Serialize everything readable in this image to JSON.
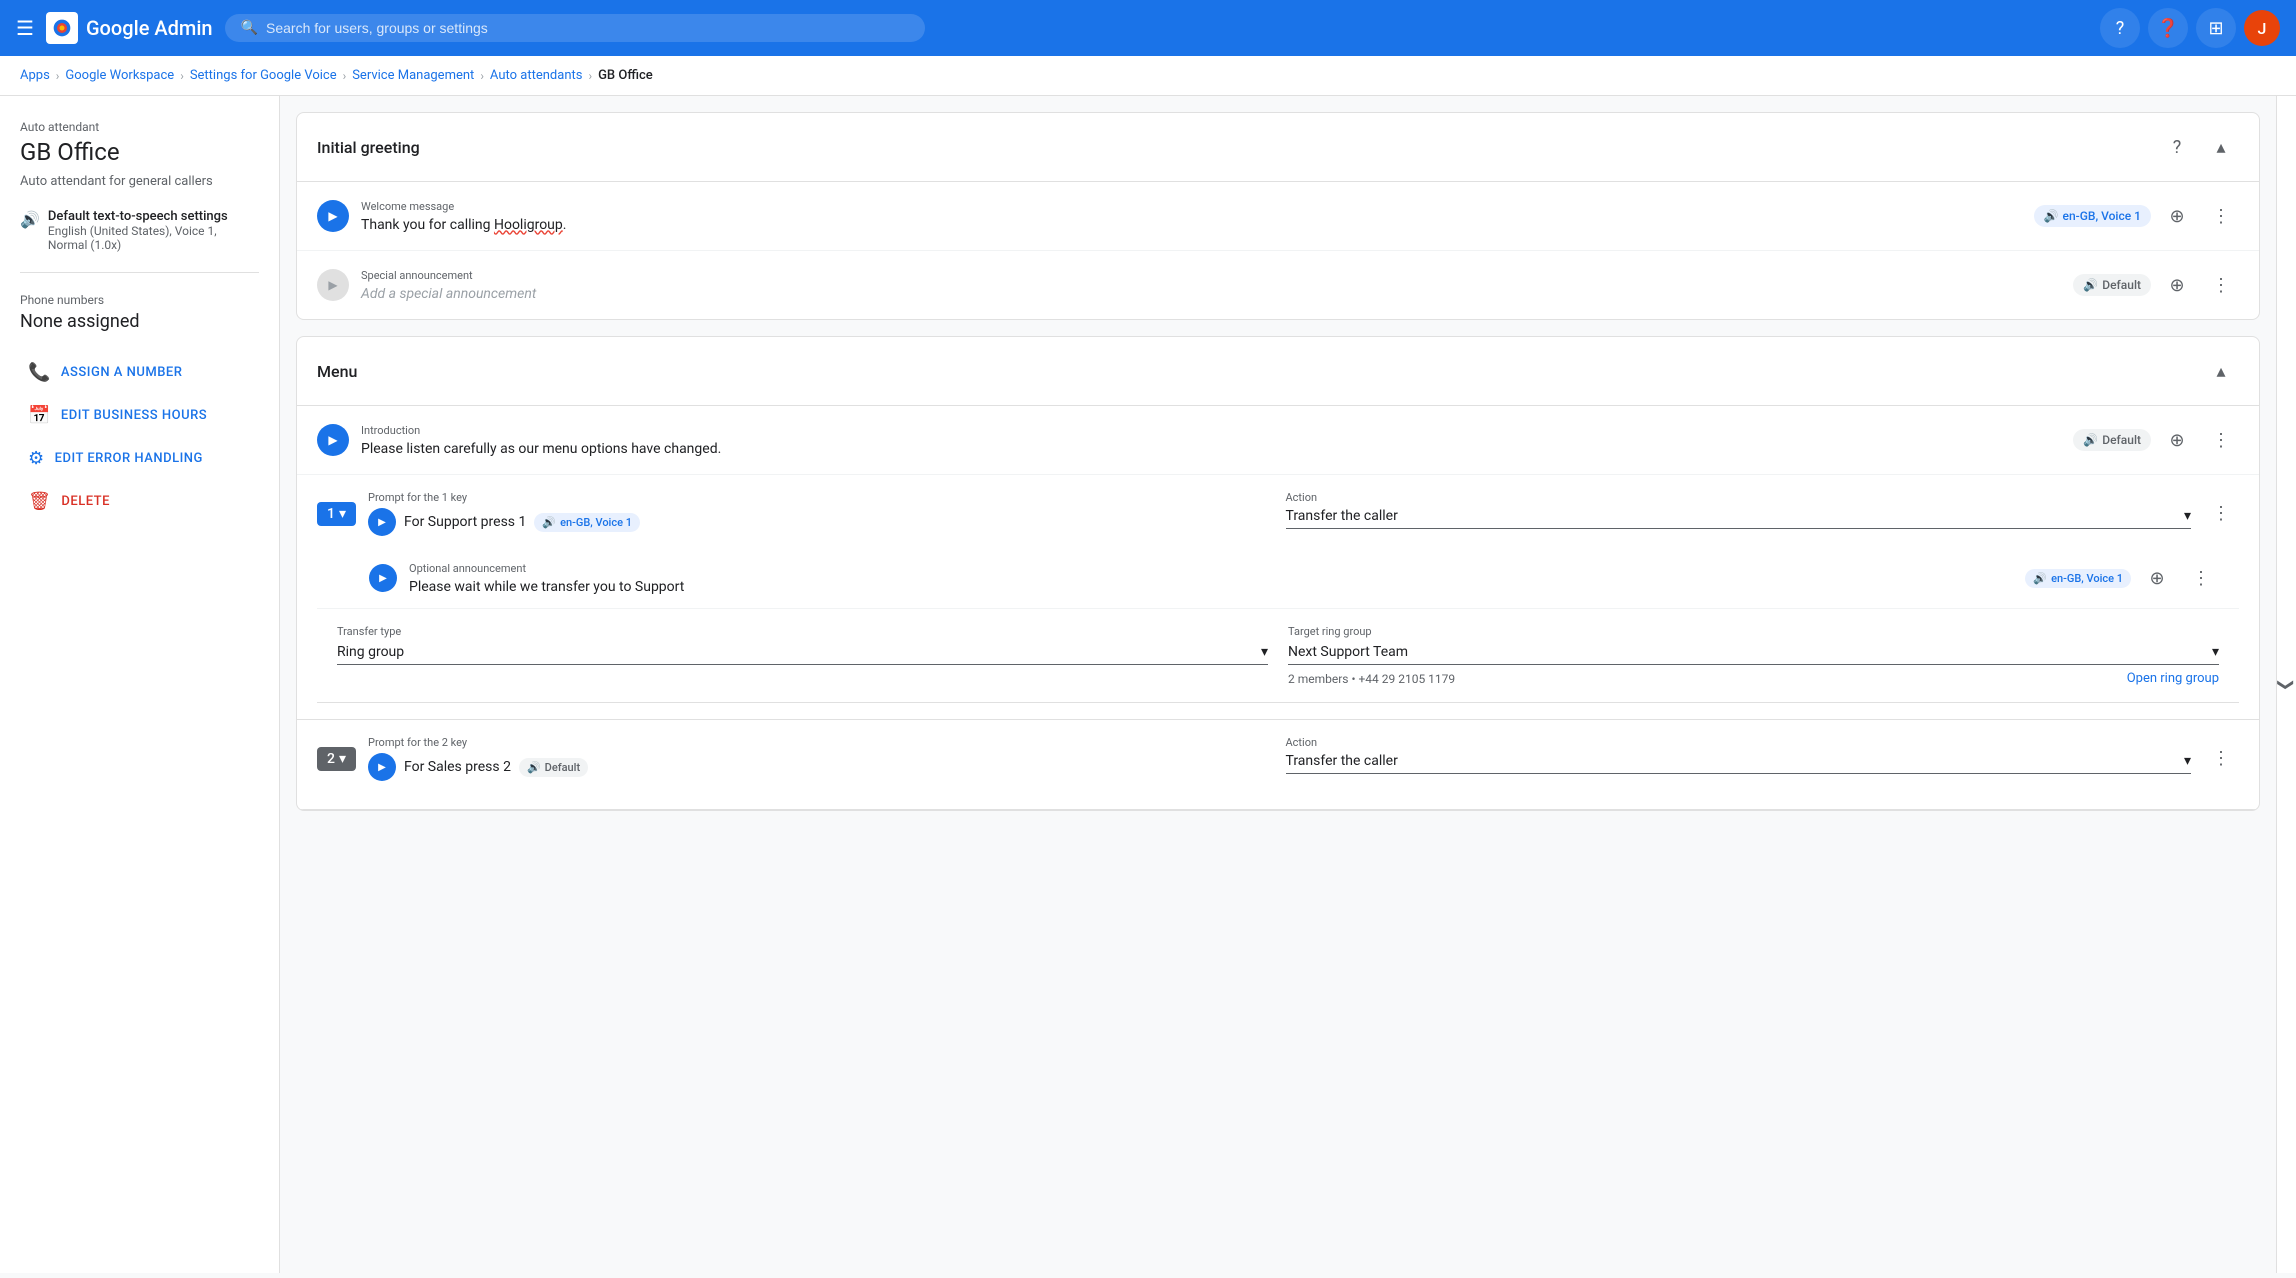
{
  "nav": {
    "hamburger_icon": "☰",
    "logo_text": "Google Admin",
    "search_placeholder": "Search for users, groups or settings",
    "help_label": "?",
    "apps_icon": "⊞",
    "avatar_letter": "J"
  },
  "breadcrumb": {
    "items": [
      "Apps",
      "Google Workspace",
      "Settings for Google Voice",
      "Service Management",
      "Auto attendants",
      "GB Office"
    ]
  },
  "sidebar": {
    "subtitle": "Auto attendant",
    "title": "GB Office",
    "description": "Auto attendant for general callers",
    "tts_label": "Default text-to-speech settings",
    "tts_detail": "English (United States), Voice 1, Normal (1.0x)",
    "phone_section_label": "Phone numbers",
    "phone_none": "None assigned",
    "actions": [
      {
        "id": "assign",
        "icon": "📞",
        "label": "ASSIGN A NUMBER"
      },
      {
        "id": "business_hours",
        "icon": "📅",
        "label": "EDIT BUSINESS HOURS"
      },
      {
        "id": "error_handling",
        "icon": "⚙",
        "label": "EDIT ERROR HANDLING"
      },
      {
        "id": "delete",
        "icon": "🗑",
        "label": "DELETE",
        "danger": true
      }
    ]
  },
  "initial_greeting": {
    "section_title": "Initial greeting",
    "welcome_label": "Welcome message",
    "welcome_text_prefix": "Thank you for calling ",
    "welcome_text_link": "Hooligroup",
    "welcome_text_suffix": ".",
    "voice_badge": "en-GB, Voice 1",
    "special_label": "Special announcement",
    "special_placeholder": "Add a special announcement",
    "special_badge": "Default"
  },
  "menu": {
    "section_title": "Menu",
    "intro_label": "Introduction",
    "intro_text": "Please listen carefully as our menu options have changed.",
    "intro_badge": "Default",
    "key1": {
      "number": "1",
      "prompt_label": "Prompt for the 1 key",
      "prompt_text": "For Support press 1",
      "voice_badge": "en-GB, Voice 1",
      "action_label": "Action",
      "action_value": "Transfer the caller",
      "optional_label": "Optional announcement",
      "optional_text": "Please wait while we transfer you to Support",
      "optional_badge": "en-GB, Voice 1",
      "transfer_type_label": "Transfer type",
      "transfer_type_value": "Ring group",
      "target_label": "Target ring group",
      "target_value": "Next Support Team",
      "target_info": "2 members • +44 29 2105 1179",
      "open_link": "Open ring group"
    },
    "key2": {
      "number": "2",
      "prompt_label": "Prompt for the 2 key",
      "prompt_text": "For Sales press 2",
      "voice_badge": "Default",
      "action_label": "Action",
      "action_value": "Transfer the caller"
    }
  },
  "icons": {
    "play": "▶",
    "chevron_down": "▾",
    "chevron_up": "▴",
    "plus": "+",
    "more_vert": "⋮",
    "question": "?",
    "speaker": "🔊",
    "phone": "📞",
    "calendar": "📅",
    "settings": "⚙",
    "trash": "🗑",
    "collapse_right": "❯"
  }
}
